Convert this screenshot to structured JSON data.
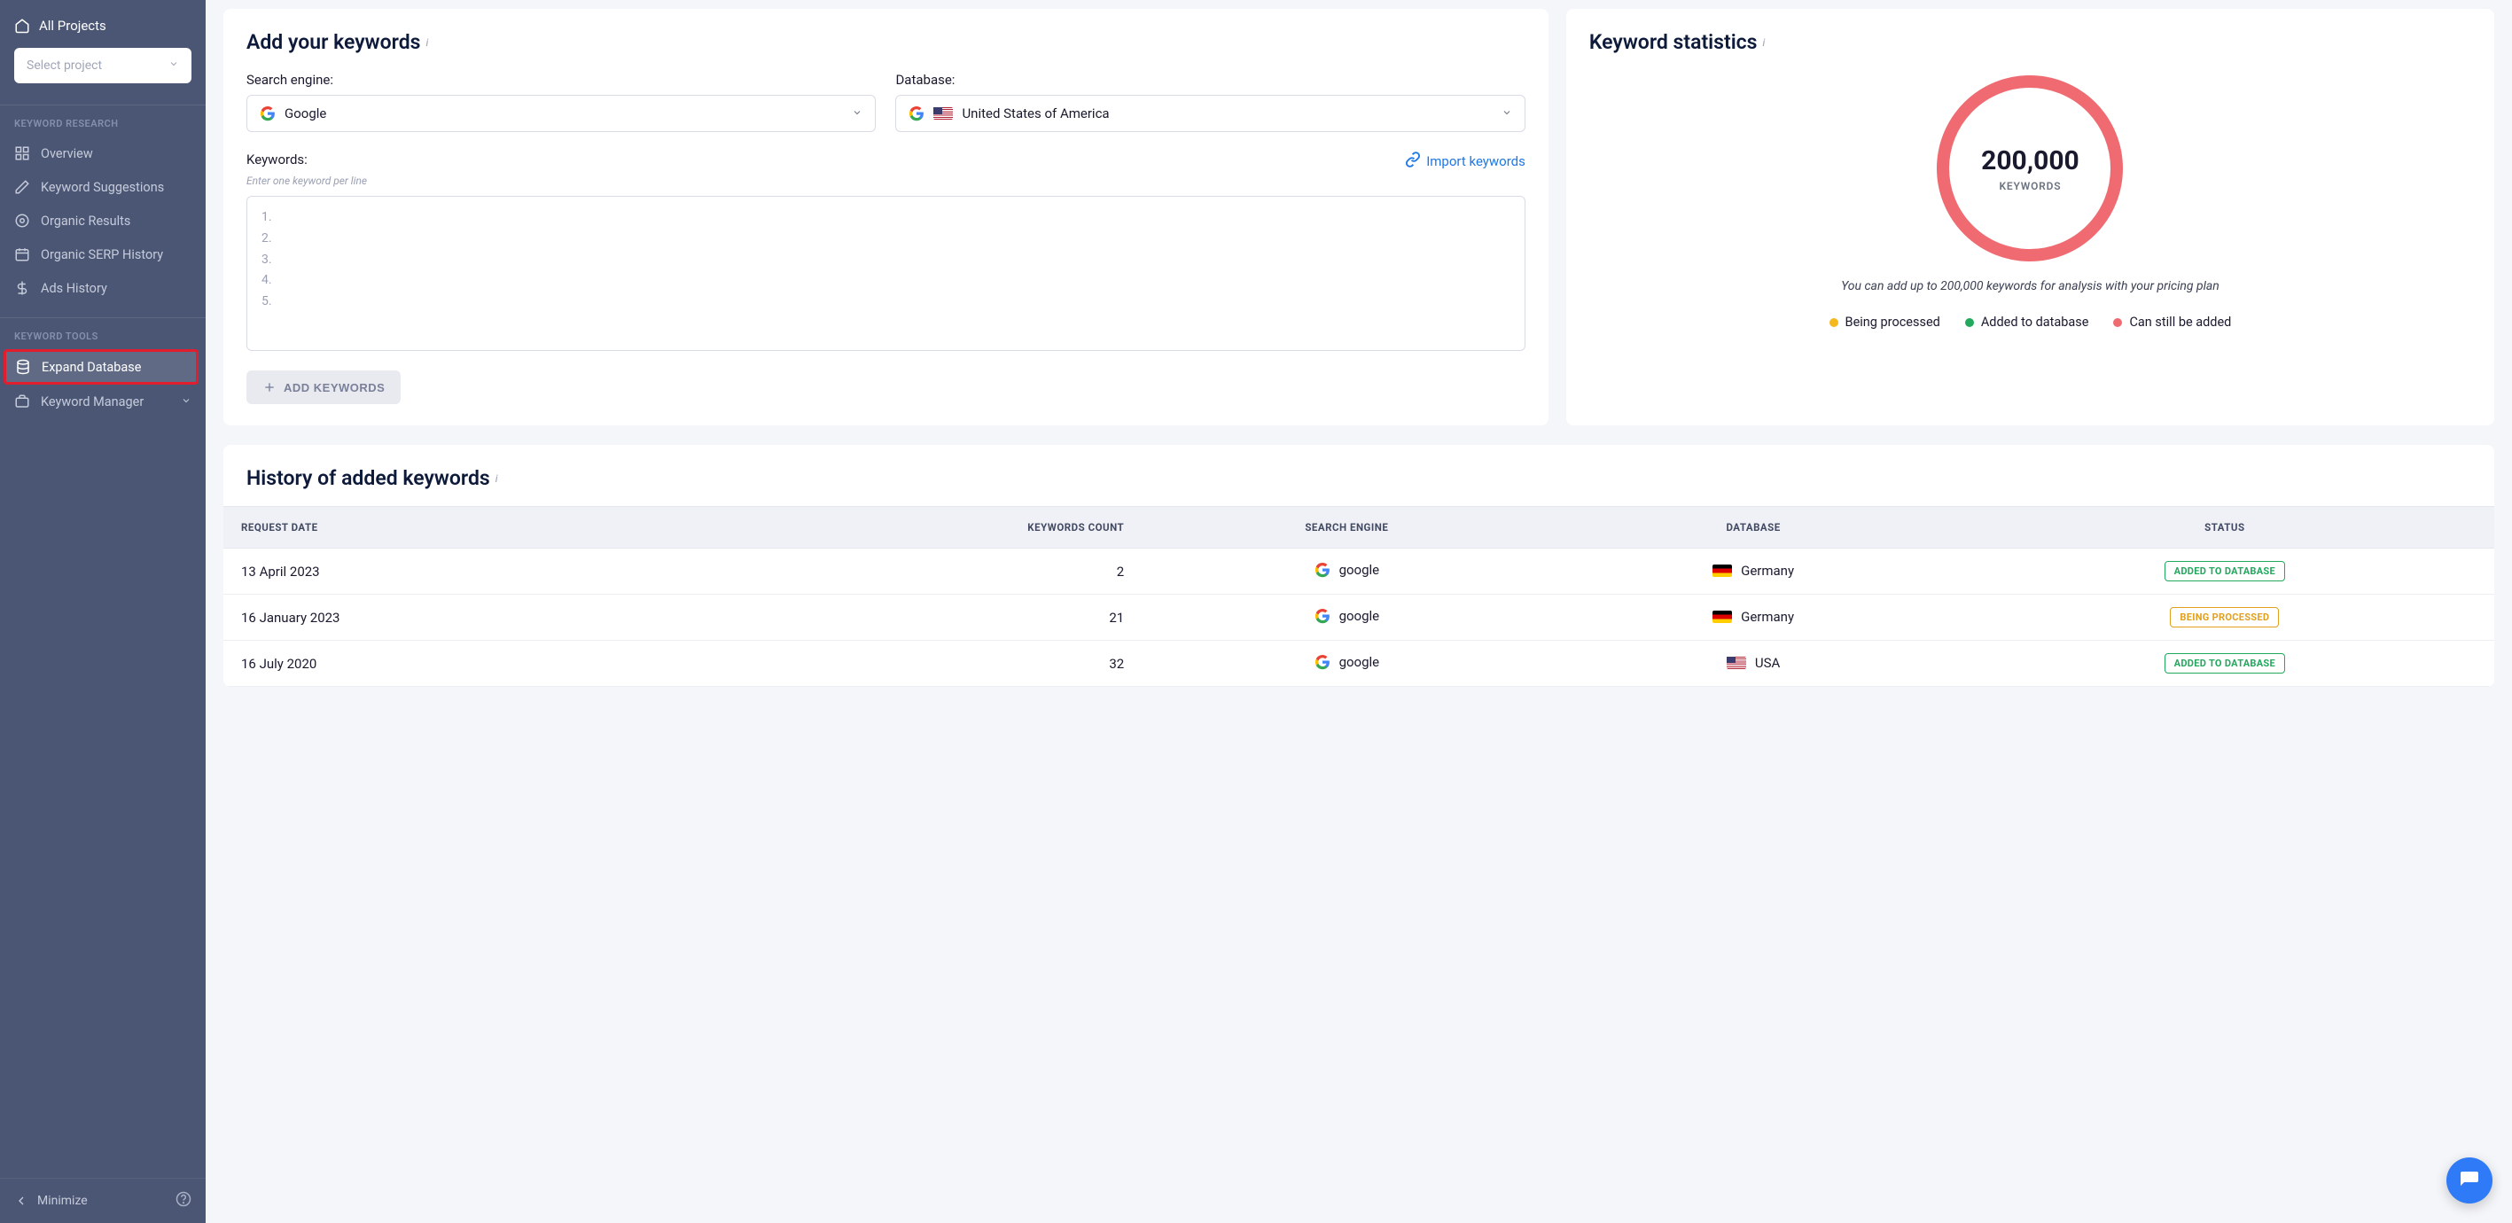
{
  "sidebar": {
    "all_projects": "All Projects",
    "select_project": "Select project",
    "section_research": "KEYWORD RESEARCH",
    "section_tools": "KEYWORD TOOLS",
    "items_research": [
      {
        "icon": "grid",
        "label": "Overview"
      },
      {
        "icon": "pencil",
        "label": "Keyword Suggestions"
      },
      {
        "icon": "target",
        "label": "Organic Results"
      },
      {
        "icon": "calendar",
        "label": "Organic SERP History"
      },
      {
        "icon": "dollar",
        "label": "Ads History"
      }
    ],
    "items_tools": [
      {
        "icon": "database",
        "label": "Expand Database"
      },
      {
        "icon": "briefcase",
        "label": "Keyword Manager"
      }
    ],
    "minimize": "Minimize"
  },
  "add_card": {
    "title": "Add your keywords",
    "search_engine_label": "Search engine:",
    "search_engine_value": "Google",
    "database_label": "Database:",
    "database_value": "United States of America",
    "keywords_label": "Keywords:",
    "keywords_hint": "Enter one keyword per line",
    "import_link": "Import keywords",
    "lines": [
      "1.",
      "2.",
      "3.",
      "4.",
      "5."
    ],
    "add_button": "ADD KEYWORDS"
  },
  "stats_card": {
    "title": "Keyword statistics",
    "count": "200,000",
    "count_label": "KEYWORDS",
    "note": "You can add up to 200,000 keywords for analysis with your pricing plan",
    "legend": [
      {
        "color": "#f5b81f",
        "label": "Being processed"
      },
      {
        "color": "#22a95e",
        "label": "Added to database"
      },
      {
        "color": "#ef6b71",
        "label": "Can still be added"
      }
    ]
  },
  "history": {
    "title": "History of added keywords",
    "columns": [
      "REQUEST DATE",
      "KEYWORDS COUNT",
      "SEARCH ENGINE",
      "DATABASE",
      "STATUS"
    ],
    "rows": [
      {
        "date": "13 April 2023",
        "count": "2",
        "engine": "google",
        "db_flag": "de",
        "db": "Germany",
        "status": "ADDED TO DATABASE",
        "status_type": "green"
      },
      {
        "date": "16 January 2023",
        "count": "21",
        "engine": "google",
        "db_flag": "de",
        "db": "Germany",
        "status": "BEING PROCESSED",
        "status_type": "orange"
      },
      {
        "date": "16 July 2020",
        "count": "32",
        "engine": "google",
        "db_flag": "us",
        "db": "USA",
        "status": "ADDED TO DATABASE",
        "status_type": "green"
      }
    ]
  }
}
